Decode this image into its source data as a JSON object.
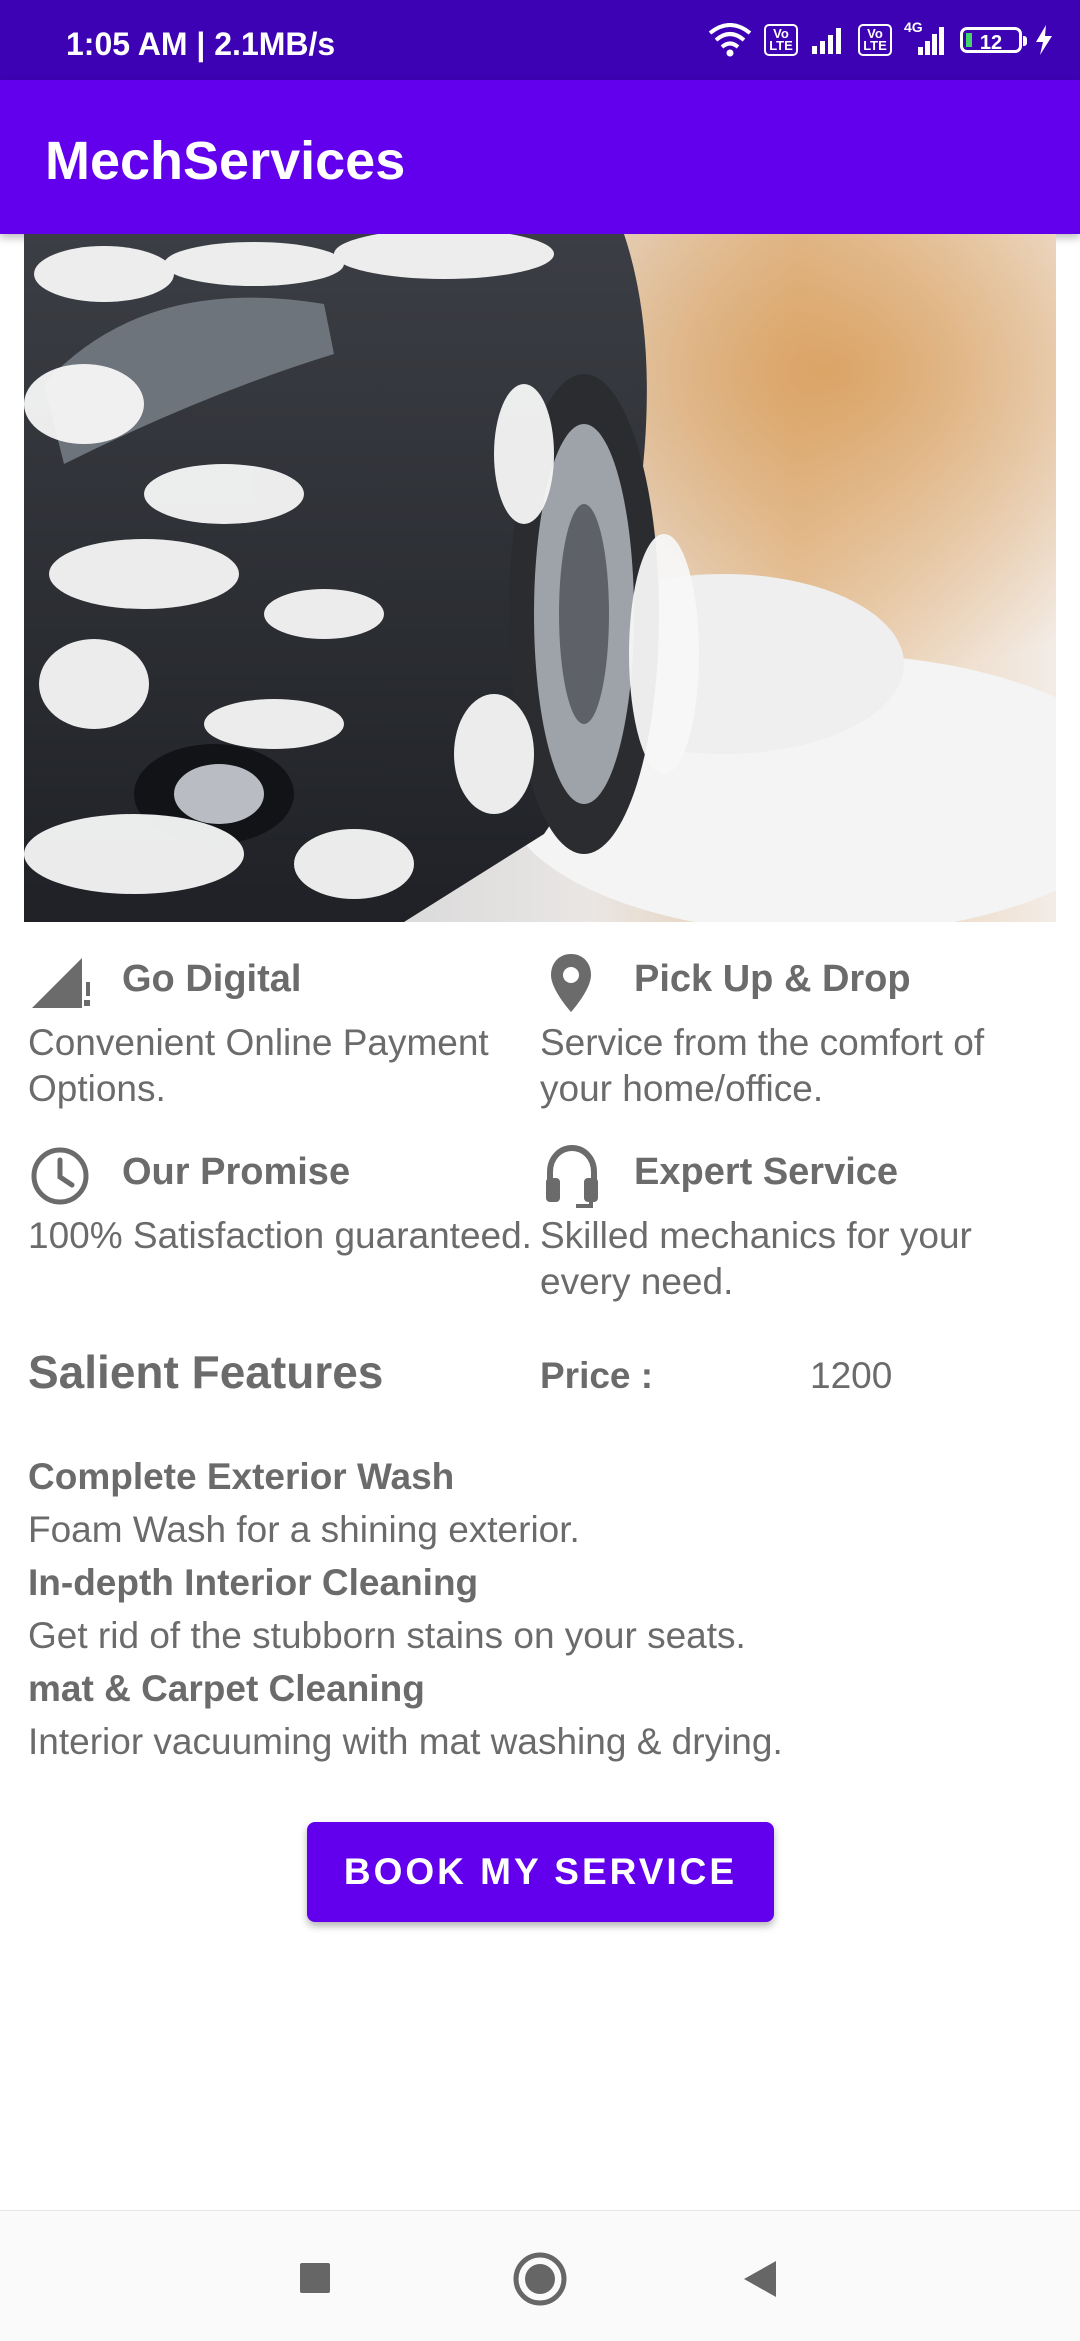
{
  "status_bar": {
    "time": "1:05 AM | 2.1MB/s",
    "volte_1": "Vo LTE",
    "volte_2": "Vo LTE",
    "network_type": "4G",
    "battery": "12"
  },
  "app_bar": {
    "title": "MechServices"
  },
  "hero_image": {
    "alt": "car foam wash"
  },
  "features": [
    {
      "title": "Go Digital",
      "desc": "Convenient Online Payment Options.",
      "icon": "signal-icon"
    },
    {
      "title": "Pick Up & Drop",
      "desc": "Service from the comfort of your home/office.",
      "icon": "location-pin-icon"
    },
    {
      "title": "Our Promise",
      "desc": "100% Satisfaction guaranteed.",
      "icon": "clock-icon"
    },
    {
      "title": "Expert Service",
      "desc": "Skilled mechanics for your every need.",
      "icon": "headset-icon"
    }
  ],
  "salient": {
    "title": "Salient Features",
    "price_label": "Price :",
    "price_value": "1200",
    "items": [
      {
        "title": "Complete Exterior Wash",
        "desc": "Foam Wash for a shining exterior."
      },
      {
        "title": "In-depth Interior Cleaning",
        "desc": "Get rid of the stubborn stains on your seats."
      },
      {
        "title": "mat & Carpet Cleaning",
        "desc": "Interior vacuuming with mat washing & drying."
      }
    ]
  },
  "book_button": {
    "label": "BOOK MY SERVICE"
  },
  "colors": {
    "primary": "#6200ee",
    "status_bar": "#3d02b3",
    "text": "#6b6b6b"
  }
}
